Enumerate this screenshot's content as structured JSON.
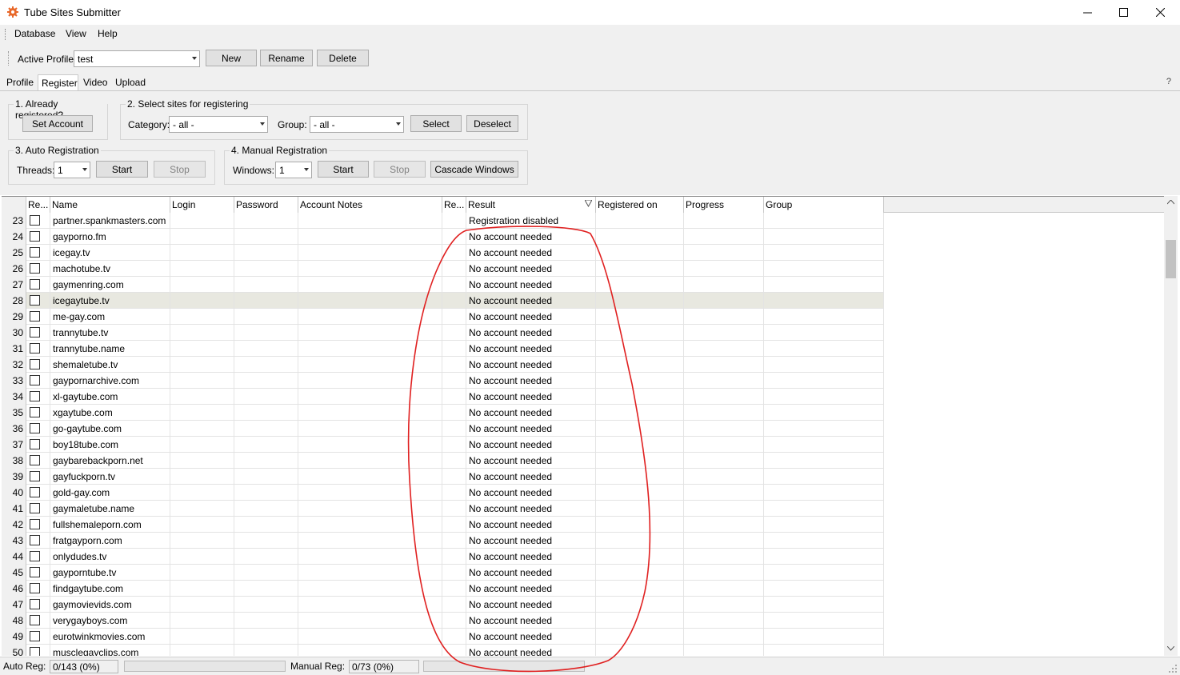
{
  "window": {
    "title": "Tube Sites Submitter",
    "minimize": "—",
    "maximize": "☐",
    "close": "✕"
  },
  "menu": [
    "Database",
    "View",
    "Help"
  ],
  "profile": {
    "label": "Active Profile:",
    "value": "test",
    "new": "New",
    "rename": "Rename",
    "delete": "Delete"
  },
  "tabs": [
    "Profile",
    "Register",
    "Video",
    "Upload"
  ],
  "help_glyph": "?",
  "step1": {
    "title": "1. Already registered?",
    "button": "Set Account"
  },
  "step2": {
    "title": "2. Select sites for registering",
    "category_label": "Category:",
    "category_value": "- all -",
    "group_label": "Group:",
    "group_value": "- all -",
    "select": "Select",
    "deselect": "Deselect"
  },
  "step3": {
    "title": "3. Auto Registration",
    "threads_label": "Threads:",
    "threads_value": "1",
    "start": "Start",
    "stop": "Stop"
  },
  "step4": {
    "title": "4. Manual Registration",
    "windows_label": "Windows:",
    "windows_value": "1",
    "start": "Start",
    "stop": "Stop",
    "cascade": "Cascade Windows"
  },
  "grid": {
    "columns": [
      "",
      "Re...",
      "Name",
      "Login",
      "Password",
      "Account Notes",
      "Re...",
      "Result",
      "Registered on",
      "Progress",
      "Group"
    ],
    "sort_column": "Result",
    "selected_row": 28,
    "rows": [
      {
        "n": "23",
        "name": "partner.spankmasters.com",
        "result": "Registration disabled"
      },
      {
        "n": "24",
        "name": "gayporno.fm",
        "result": "No account needed"
      },
      {
        "n": "25",
        "name": "icegay.tv",
        "result": "No account needed"
      },
      {
        "n": "26",
        "name": "machotube.tv",
        "result": "No account needed"
      },
      {
        "n": "27",
        "name": "gaymenring.com",
        "result": "No account needed"
      },
      {
        "n": "28",
        "name": "icegaytube.tv",
        "result": "No account needed"
      },
      {
        "n": "29",
        "name": "me-gay.com",
        "result": "No account needed"
      },
      {
        "n": "30",
        "name": "trannytube.tv",
        "result": "No account needed"
      },
      {
        "n": "31",
        "name": "trannytube.name",
        "result": "No account needed"
      },
      {
        "n": "32",
        "name": "shemaletube.tv",
        "result": "No account needed"
      },
      {
        "n": "33",
        "name": "gaypornarchive.com",
        "result": "No account needed"
      },
      {
        "n": "34",
        "name": "xl-gaytube.com",
        "result": "No account needed"
      },
      {
        "n": "35",
        "name": "xgaytube.com",
        "result": "No account needed"
      },
      {
        "n": "36",
        "name": "go-gaytube.com",
        "result": "No account needed"
      },
      {
        "n": "37",
        "name": "boy18tube.com",
        "result": "No account needed"
      },
      {
        "n": "38",
        "name": "gaybarebackporn.net",
        "result": "No account needed"
      },
      {
        "n": "39",
        "name": "gayfuckporn.tv",
        "result": "No account needed"
      },
      {
        "n": "40",
        "name": "gold-gay.com",
        "result": "No account needed"
      },
      {
        "n": "41",
        "name": "gaymaletube.name",
        "result": "No account needed"
      },
      {
        "n": "42",
        "name": "fullshemaleporn.com",
        "result": "No account needed"
      },
      {
        "n": "43",
        "name": "fratgayporn.com",
        "result": "No account needed"
      },
      {
        "n": "44",
        "name": "onlydudes.tv",
        "result": "No account needed"
      },
      {
        "n": "45",
        "name": "gayporntube.tv",
        "result": "No account needed"
      },
      {
        "n": "46",
        "name": "findgaytube.com",
        "result": "No account needed"
      },
      {
        "n": "47",
        "name": "gaymovievids.com",
        "result": "No account needed"
      },
      {
        "n": "48",
        "name": "verygayboys.com",
        "result": "No account needed"
      },
      {
        "n": "49",
        "name": "eurotwinkmovies.com",
        "result": "No account needed"
      },
      {
        "n": "50",
        "name": "musclegayclips.com",
        "result": "No account needed"
      }
    ]
  },
  "status": {
    "auto_label": "Auto Reg:",
    "auto_value": "0/143 (0%)",
    "manual_label": "Manual Reg:",
    "manual_value": "0/73 (0%)"
  },
  "colors": {
    "annotation": "#e02020",
    "accent_icon": "#e8682a"
  }
}
